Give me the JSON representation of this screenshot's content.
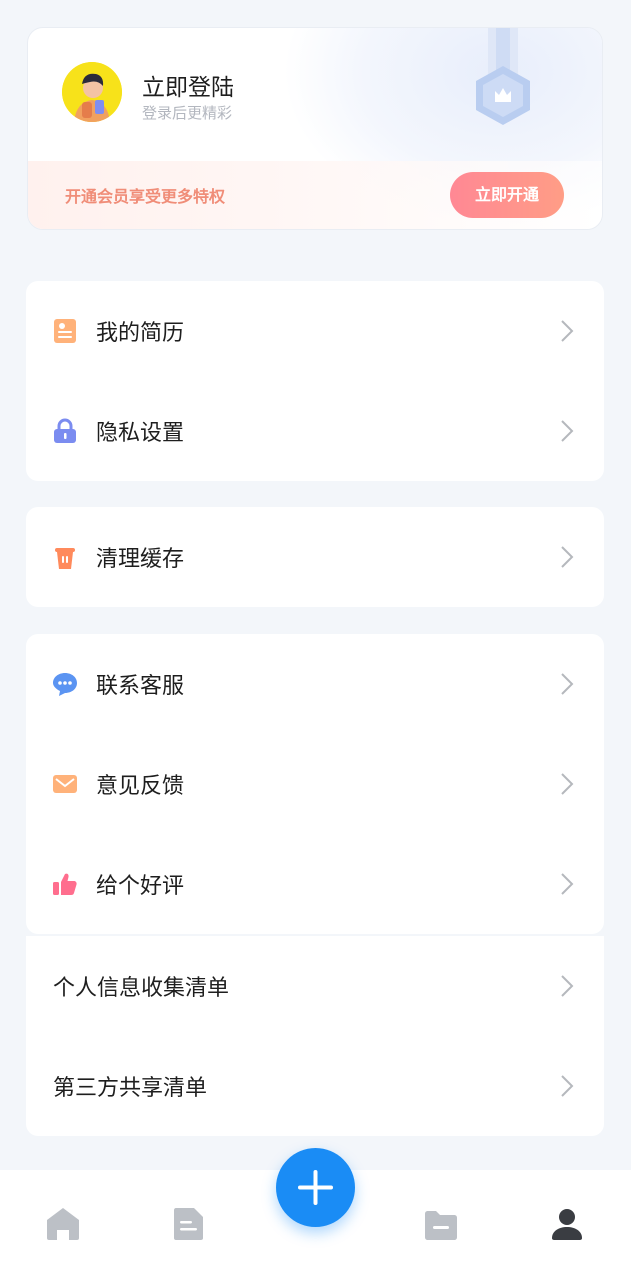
{
  "profile": {
    "title": "立即登陆",
    "subtitle": "登录后更精彩",
    "vip_text": "开通会员享受更多特权",
    "vip_button": "立即开通"
  },
  "menu": {
    "resume": "我的简历",
    "privacy": "隐私设置",
    "cache": "清理缓存",
    "service": "联系客服",
    "feedback": "意见反馈",
    "rate": "给个好评",
    "personal_info": "个人信息收集清单",
    "third_party": "第三方共享清单"
  },
  "tabbar": {
    "items": [
      "home-icon",
      "document-icon",
      "add-icon",
      "folder-icon",
      "user-icon"
    ],
    "active": "user-icon",
    "accent": "#1a8cf5"
  },
  "colors": {
    "background": "#f3f6fa",
    "vip_button": "#ff8894",
    "vip_text": "#f08d78"
  }
}
